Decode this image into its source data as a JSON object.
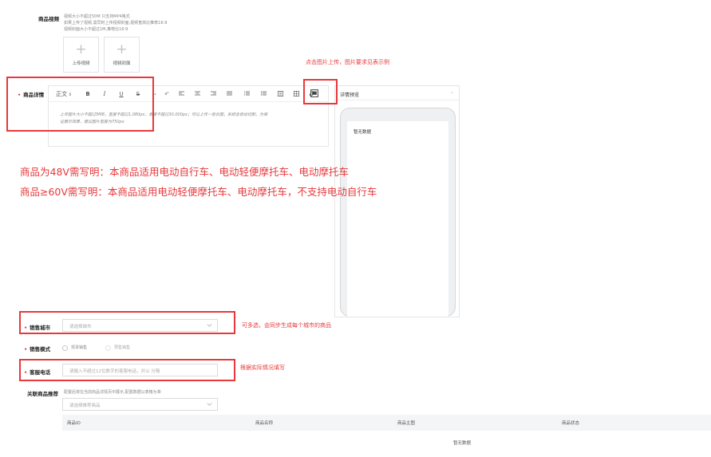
{
  "video": {
    "label": "商品视频",
    "hints": [
      "视频大小不超过50M 只支持MP4格式",
      "如果上传了视频,需同时上传视频封面,视频宽高比推荐16:9",
      "视频封面大小不超过1M,推荐比16:9"
    ],
    "upload_video": "上传视频",
    "upload_cover": "视频封面"
  },
  "detail": {
    "label": "商品详情",
    "toolbar": {
      "format": "正文",
      "bold": "B",
      "italic": "I",
      "underline": "U",
      "strike": "S",
      "sub": "x₂",
      "sup": "x²"
    },
    "hint_line1": "上传图片大小不超过5MB，宽度不超过1,080px，高度不超过30,000px；可以上传一张长图，系统会自动切割，为保",
    "hint_line2": "证展示效果，建议图片宽度为750px"
  },
  "preview": {
    "title": "详情预览",
    "empty": "暂无数据"
  },
  "annotations": {
    "upload_tip": "点击图片上传，图片要求见表示例",
    "rule_48v": "商品为48V需写明：本商品适用电动自行车、电动轻便摩托车、电动摩托车",
    "rule_60v": "商品≥60V需写明：本商品适用电动轻便摩托车、电动摩托车，不支持电动自行车",
    "city_tip": "可多选，会同步生成每个城市的商品",
    "phone_tip": "根据实际情况填写"
  },
  "city": {
    "label": "销售城市",
    "placeholder": "请选择城市"
  },
  "mode": {
    "label": "销售模式",
    "options": [
      "现货销售",
      "预售销售"
    ]
  },
  "phone": {
    "label": "客服电话",
    "placeholder": "请输入不超过12位数字的客服电话，并以 分隔"
  },
  "related": {
    "label": "关联商品推荐",
    "hint": "配置后将在当前商品详情页中展示,配置数据以表格为准",
    "placeholder": "请选择推荐商品",
    "columns": [
      "商品ID",
      "商品名称",
      "商品主图",
      "商品状态"
    ],
    "empty": "暂无数据"
  },
  "colors": {
    "annotation_red": "#e8383b",
    "required_red": "#e4393c",
    "border": "#dcdcdc",
    "table_header_bg": "#f4f5f7"
  }
}
